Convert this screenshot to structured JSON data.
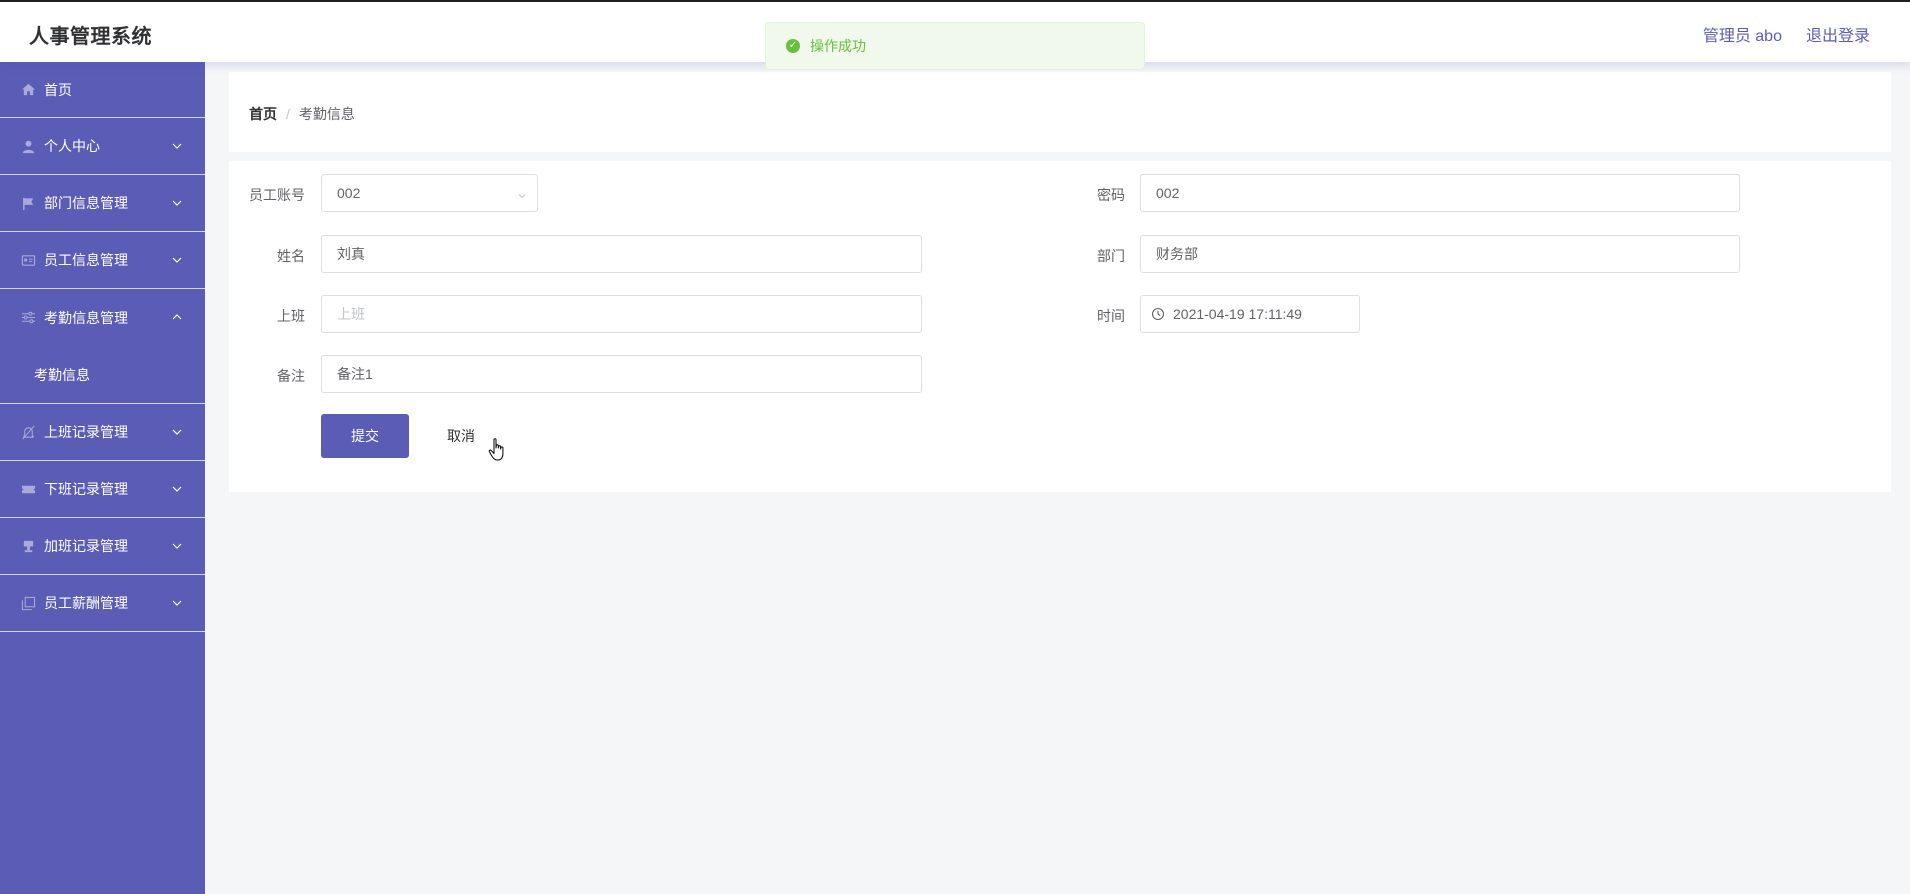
{
  "header": {
    "title": "人事管理系统",
    "user_label": "管理员 abo",
    "logout_label": "退出登录"
  },
  "toast": {
    "message": "操作成功"
  },
  "sidebar": {
    "items": [
      {
        "label": "首页",
        "icon": "home-icon"
      },
      {
        "label": "个人中心",
        "icon": "user-icon"
      },
      {
        "label": "部门信息管理",
        "icon": "flag-icon"
      },
      {
        "label": "员工信息管理",
        "icon": "id-card-icon"
      },
      {
        "label": "考勤信息管理",
        "icon": "sliders-icon",
        "expanded": true,
        "children": [
          "考勤信息"
        ]
      },
      {
        "label": "上班记录管理",
        "icon": "bell-off-icon"
      },
      {
        "label": "下班记录管理",
        "icon": "ticket-icon"
      },
      {
        "label": "加班记录管理",
        "icon": "stamp-icon"
      },
      {
        "label": "员工薪酬管理",
        "icon": "copy-icon"
      }
    ]
  },
  "breadcrumb": {
    "home": "首页",
    "separator": "/",
    "current": "考勤信息"
  },
  "form": {
    "account": {
      "label": "员工账号",
      "value": "002"
    },
    "password": {
      "label": "密码",
      "value": "002"
    },
    "name": {
      "label": "姓名",
      "value": "刘真"
    },
    "department": {
      "label": "部门",
      "value": "财务部"
    },
    "clock_in": {
      "label": "上班",
      "placeholder": "上班",
      "value": ""
    },
    "time": {
      "label": "时间",
      "value": "2021-04-19 17:11:49"
    },
    "remark": {
      "label": "备注",
      "value": "备注1"
    },
    "submit_label": "提交",
    "cancel_label": "取消"
  },
  "colors": {
    "accent": "#5b5cb6",
    "success": "#67c23a",
    "background": "#f5f6f8"
  }
}
